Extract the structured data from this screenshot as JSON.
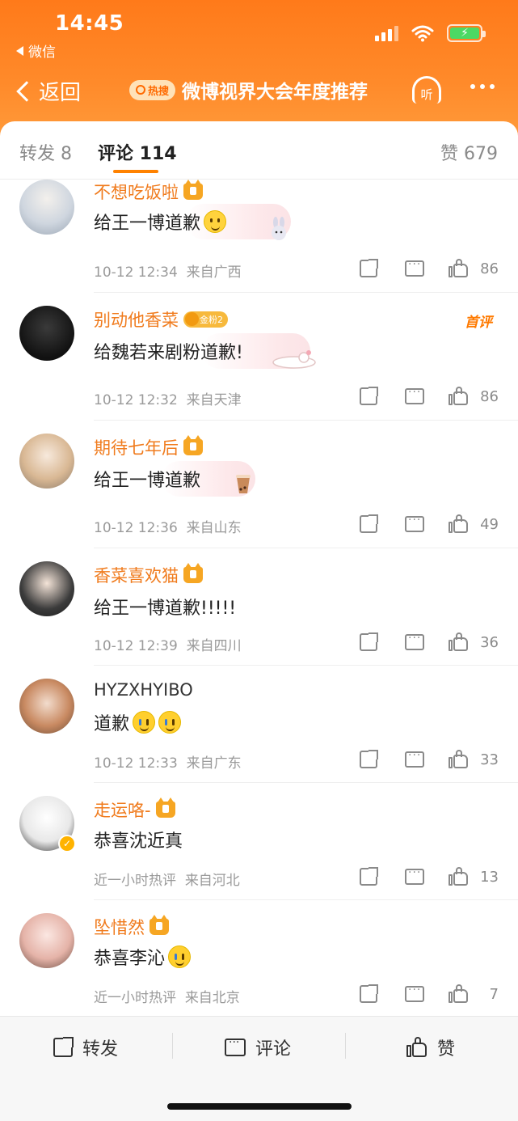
{
  "status": {
    "time": "14:45",
    "back_app": "微信"
  },
  "nav": {
    "back_label": "返回",
    "hot_tag": "热搜",
    "title": "微博视界大会年度推荐",
    "listen_label": "听"
  },
  "tabs": {
    "forward": "转发 8",
    "comment": "评论 114",
    "likes": "赞 679"
  },
  "comments": [
    {
      "user": "不想吃饭啦",
      "badge": "crown",
      "text": "给王一博道歉",
      "emoji": "smile",
      "time": "10-12 12:34",
      "location": "来自广西",
      "likes": "86"
    },
    {
      "user": "别动他香菜",
      "badge": "金粉2",
      "text": "给魏若来剧粉道歉!",
      "emoji": "",
      "time": "10-12 12:32",
      "location": "来自天津",
      "likes": "86",
      "top_label": "首评"
    },
    {
      "user": "期待七年后",
      "badge": "crown",
      "text": "给王一博道歉",
      "emoji": "",
      "time": "10-12 12:36",
      "location": "来自山东",
      "likes": "49"
    },
    {
      "user": "香菜喜欢猫",
      "badge": "crown",
      "text": "给王一博道歉!!!!!",
      "emoji": "",
      "time": "10-12 12:39",
      "location": "来自四川",
      "likes": "36"
    },
    {
      "user": "HYZXHYIBO",
      "badge": "",
      "text": "道歉",
      "emoji": "cry",
      "time": "10-12 12:33",
      "location": "来自广东",
      "likes": "33"
    },
    {
      "user": "走运咯-",
      "badge": "crown",
      "text": "恭喜沈近真",
      "emoji": "",
      "time": "近一小时热评",
      "location": "来自河北",
      "likes": "13",
      "verified": true
    },
    {
      "user": "坠惜然",
      "badge": "crown",
      "text": "恭喜李沁",
      "emoji": "laugh-cry",
      "time": "近一小时热评",
      "location": "来自北京",
      "likes": "7"
    }
  ],
  "bottom_bar": {
    "forward": "转发",
    "comment": "评论",
    "like": "赞"
  },
  "colors": {
    "accent": "#ff8200",
    "username": "#f07b1d",
    "top_gradient": "#ff7a1a"
  }
}
